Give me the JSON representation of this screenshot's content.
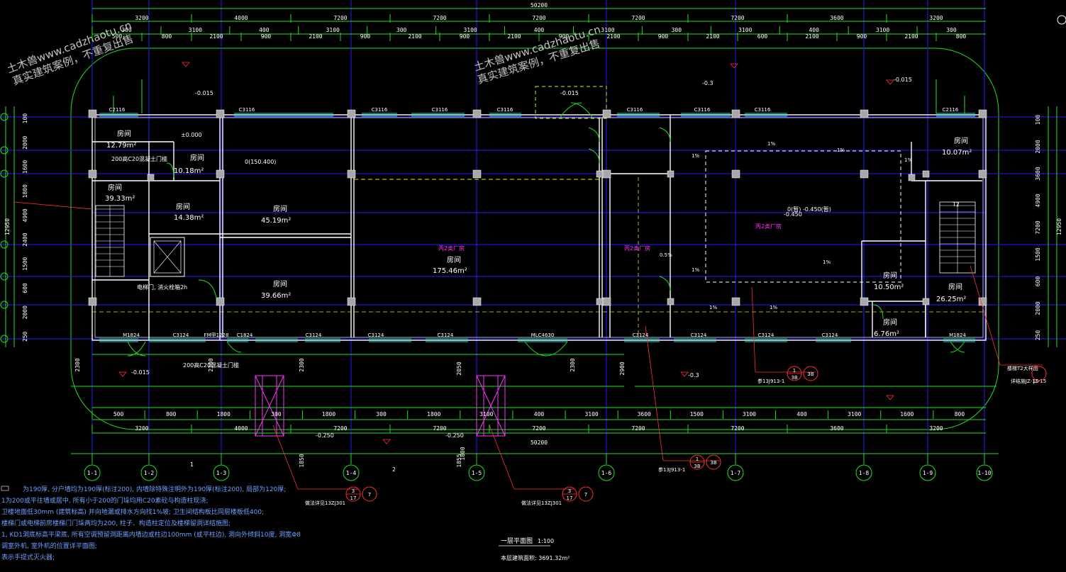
{
  "watermark": {
    "left_line1": "土木兽www.cadzhaotu.cn",
    "left_line2": "真实建筑案例，不重复出售",
    "right_line1": "土木兽www.cadzhaotu.cn",
    "right_line2": "真实建筑案例，不重复出售"
  },
  "drawing": {
    "title": "一层平面图",
    "scale": "1:100",
    "total_top": "50200",
    "total_bottom": "50200",
    "building_area": "本层建筑面积: 3691.32m²"
  },
  "dims": {
    "top_row1": [
      "3200",
      "4000",
      "7200",
      "7200",
      "7200",
      "7200",
      "7200",
      "3600",
      "3200"
    ],
    "top_row2": [
      "300",
      "3100",
      "400",
      "3100",
      "300",
      "3100",
      "400",
      "3100",
      "300",
      "3100",
      "400",
      "3100",
      "300"
    ],
    "top_row3": [
      "500",
      "800",
      "2100",
      "900",
      "2100",
      "900",
      "2100",
      "900",
      "2100",
      "900",
      "2100",
      "900",
      "2100",
      "600",
      "2100",
      "900",
      "2100",
      "800"
    ],
    "bottom_row1": [
      "500",
      "800",
      "1800",
      "300",
      "1800",
      "300",
      "1800",
      "3100",
      "400",
      "3100",
      "3600",
      "1500",
      "3100",
      "400",
      "3100",
      "1600",
      "800"
    ],
    "bottom_row2": [
      "3200",
      "4000",
      "7200",
      "7200",
      "7200",
      "7200",
      "7200",
      "3600",
      "3200"
    ],
    "left": [
      "100",
      "2000",
      "1600",
      "1800",
      "4900",
      "2400",
      "1500",
      "600",
      "2000",
      "250"
    ],
    "left_total": "12950",
    "right": [
      "100",
      "2000",
      "3600",
      "4900",
      "7200",
      "1500",
      "600",
      "2000",
      "250"
    ],
    "right_total": "12950",
    "side_marks": [
      "2300",
      "2300",
      "2300",
      "2300",
      "2050",
      "1800",
      "2900",
      "1850",
      "1855"
    ]
  },
  "axes": [
    "1-1",
    "1-2",
    "1-3",
    "1-4",
    "1-5",
    "1-6",
    "1-7",
    "1-8",
    "1-9",
    "1-10"
  ],
  "axis_breaks": [
    "1",
    "2"
  ],
  "rooms": [
    {
      "name": "房间",
      "area": "12.79m²"
    },
    {
      "name": "房间",
      "area": "10.18m²"
    },
    {
      "name": "房间",
      "area": "39.33m²"
    },
    {
      "name": "房间",
      "area": "14.38m²"
    },
    {
      "name": "房间",
      "area": "45.19m²"
    },
    {
      "name": "房间",
      "area": "39.66m²"
    },
    {
      "name": "房间",
      "area": "175.46m²"
    },
    {
      "name": "房间",
      "area": "10.07m²"
    },
    {
      "name": "房间",
      "area": "10.50m²"
    },
    {
      "name": "房间",
      "area": "26.25m²"
    },
    {
      "name": "房间",
      "area": "6.76m²"
    }
  ],
  "elevations": [
    "±0.000",
    "-0.015",
    "-0.015",
    "-0.3",
    "-0.015",
    "-0.015",
    "-0.3",
    "-0.250",
    "-0.250",
    "-0.450",
    "0(150.400)"
  ],
  "labels": {
    "c20_top": "200高C20混凝土门槛",
    "c20_bottom": "200高C20混凝土门槛",
    "elevator": "电梯门, 消火栓箱2h",
    "window_top": [
      "C2116",
      "C3116",
      "C3116",
      "C3116",
      "C3116",
      "C3116",
      "C3116",
      "C3116",
      "C2116"
    ],
    "window_bottom": [
      "M1824",
      "C3124",
      "FM甲1228",
      "C1824",
      "C3124",
      "C3124",
      "C3124",
      "MLC4630",
      "C3124",
      "C3124",
      "C3124",
      "C3124",
      "M1824"
    ],
    "stair_t2": "T2",
    "detail_ref_a": "参13J913-1",
    "detail_ref_b": "参13J913-1",
    "detail_ref_c": "做法详见13ZJ301",
    "detail_ref_d": "做法详见13ZJ301",
    "detail_ref_e": "楼梯T2大样图",
    "detail_ref_f": "详结施JZ-15",
    "section_mark": "JZ-15",
    "magenta_a": "丙2类厂房",
    "magenta_b": "丙2类厂房",
    "magenta_c": "丙2类厂房",
    "box_label": "0(暂) -0.450(暂)",
    "pct": [
      "1%",
      "1%",
      "1%",
      "1%",
      "1%",
      "1%",
      "1%",
      "1%",
      "0.5%"
    ]
  },
  "bubbles": [
    {
      "top": "1",
      "bottom": "3B",
      "side": "3B"
    },
    {
      "top": "1",
      "bottom": "3B",
      "side": "3B"
    },
    {
      "top": "3",
      "bottom": "17",
      "side": "7"
    },
    {
      "top": "3",
      "bottom": "17",
      "side": "7"
    }
  ],
  "notes": [
    "为190厚, 分户墙均为190厚(标注200), 内墙除特殊注明外为190厚(标注200), 局部为120厚;",
    "1为200或平往墙或居中, 所有小于200的门垛均用C20素砼与构造柱现浇;",
    "卫楼地面低30mm (建筑标高) 并向地漏或排水方向找1%坡; 卫生间结构板比同层楼板低400;",
    "楼梯门或电梯前房楼梯门门垛两均为200, 柱子、构造柱定位及楼梯留洞详结施图;",
    "1, KD1洞底标高平梁底, 所有空调预留洞距离内墙边或柱边100mm (或平柱边), 洞向外倾斜10度, 洞宽Φ8",
    "调室外机, 室外机的位置详平面图;",
    "表示手提式灭火器;"
  ],
  "colors": {
    "grid": "#2020ff",
    "green": "#22e022",
    "wall": "#ffffff",
    "cyan": "#00e5e5",
    "yellow": "#e8e800",
    "magenta": "#ff33ff",
    "red": "#ff3030",
    "note": "#6fa0ff"
  }
}
